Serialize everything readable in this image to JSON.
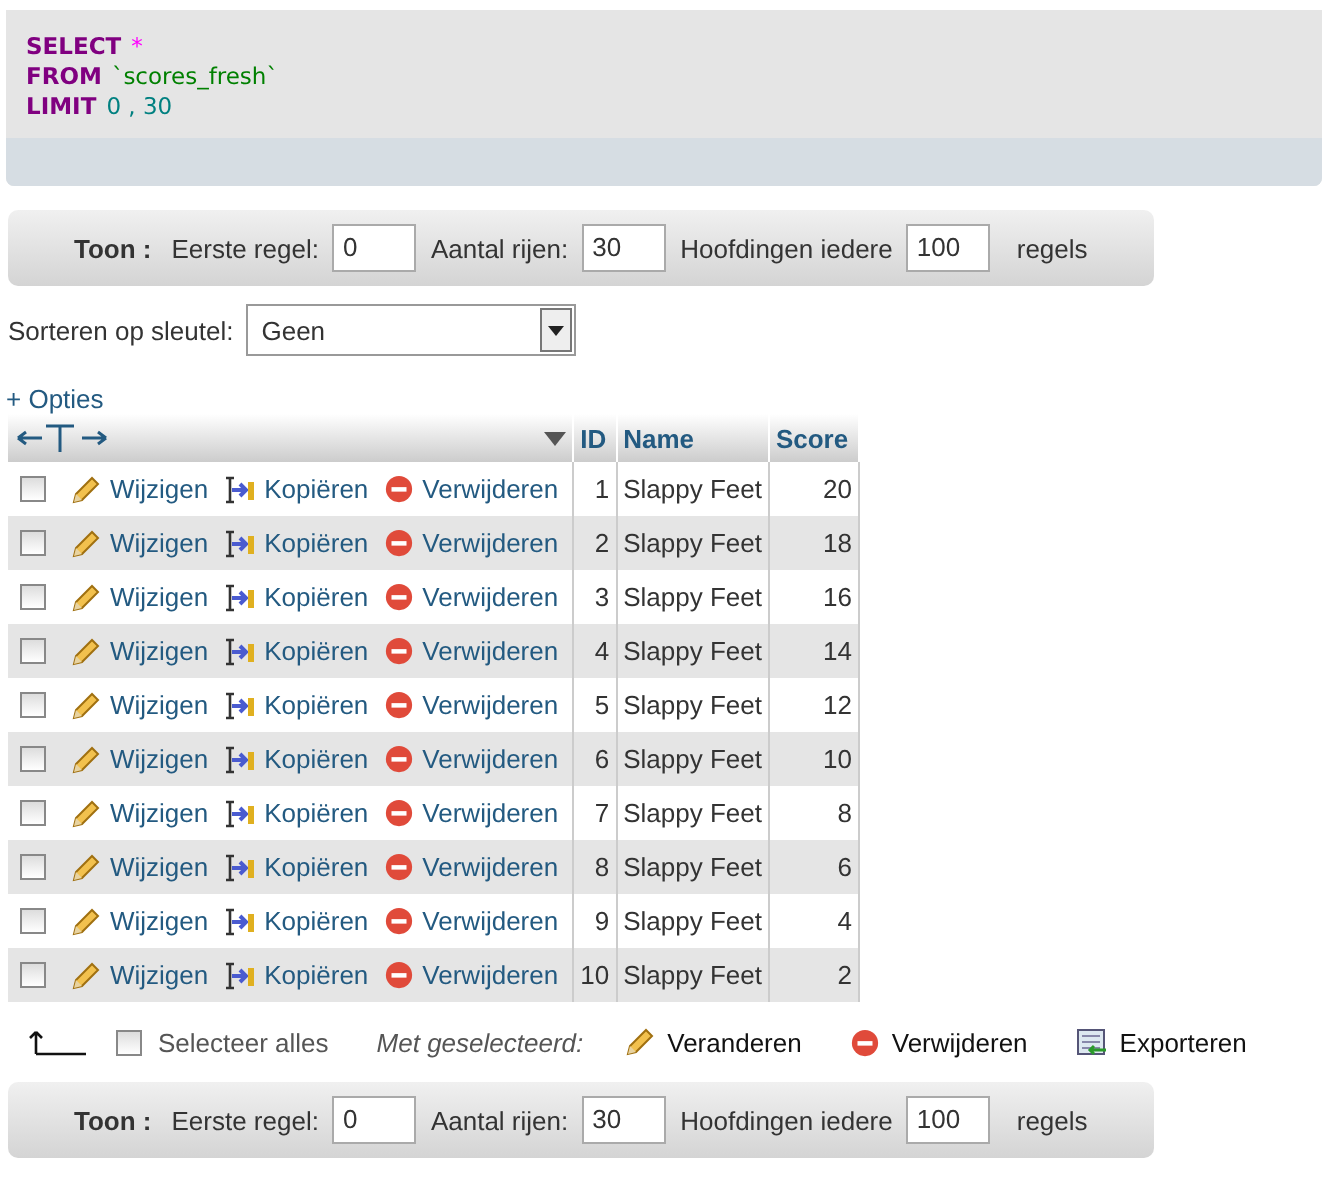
{
  "sql": [
    [
      {
        "kind": "keyword",
        "text": "SELECT"
      },
      {
        "kind": "operator",
        "text": "*"
      }
    ],
    [
      {
        "kind": "keyword",
        "text": "FROM"
      },
      {
        "kind": "string",
        "text": "`scores_fresh`"
      }
    ],
    [
      {
        "kind": "keyword",
        "text": "LIMIT"
      },
      {
        "kind": "number",
        "text": "0 , 30"
      }
    ]
  ],
  "nav_top": {
    "title": "Toon :",
    "first_label": "Eerste regel:",
    "first_value": "0",
    "rows_label": "Aantal rijen:",
    "rows_value": "30",
    "headers_label": "Hoofdingen iedere",
    "headers_value": "100",
    "suffix": "regels"
  },
  "sort": {
    "label": "Sorteren op sleutel:",
    "value": "Geen"
  },
  "options_link": "+ Opties",
  "table": {
    "columns": [
      "ID",
      "Name",
      "Score"
    ],
    "rows": [
      {
        "checked": false,
        "edit": "Wijzigen",
        "copy": "Kopiëren",
        "delete": "Verwijderen",
        "id": "1",
        "name": "Slappy Feet",
        "score": "20"
      },
      {
        "checked": false,
        "edit": "Wijzigen",
        "copy": "Kopiëren",
        "delete": "Verwijderen",
        "id": "2",
        "name": "Slappy Feet",
        "score": "18"
      },
      {
        "checked": false,
        "edit": "Wijzigen",
        "copy": "Kopiëren",
        "delete": "Verwijderen",
        "id": "3",
        "name": "Slappy Feet",
        "score": "16"
      },
      {
        "checked": false,
        "edit": "Wijzigen",
        "copy": "Kopiëren",
        "delete": "Verwijderen",
        "id": "4",
        "name": "Slappy Feet",
        "score": "14"
      },
      {
        "checked": false,
        "edit": "Wijzigen",
        "copy": "Kopiëren",
        "delete": "Verwijderen",
        "id": "5",
        "name": "Slappy Feet",
        "score": "12"
      },
      {
        "checked": false,
        "edit": "Wijzigen",
        "copy": "Kopiëren",
        "delete": "Verwijderen",
        "id": "6",
        "name": "Slappy Feet",
        "score": "10"
      },
      {
        "checked": false,
        "edit": "Wijzigen",
        "copy": "Kopiëren",
        "delete": "Verwijderen",
        "id": "7",
        "name": "Slappy Feet",
        "score": "8"
      },
      {
        "checked": false,
        "edit": "Wijzigen",
        "copy": "Kopiëren",
        "delete": "Verwijderen",
        "id": "8",
        "name": "Slappy Feet",
        "score": "6"
      },
      {
        "checked": false,
        "edit": "Wijzigen",
        "copy": "Kopiëren",
        "delete": "Verwijderen",
        "id": "9",
        "name": "Slappy Feet",
        "score": "4"
      },
      {
        "checked": false,
        "edit": "Wijzigen",
        "copy": "Kopiëren",
        "delete": "Verwijderen",
        "id": "10",
        "name": "Slappy Feet",
        "score": "2"
      }
    ]
  },
  "bulk": {
    "select_all": "Selecteer alles",
    "select_all_checked": false,
    "with_selected": "Met geselecteerd:",
    "change": "Veranderen",
    "delete": "Verwijderen",
    "export": "Exporteren"
  },
  "nav_bottom": {
    "title": "Toon :",
    "first_label": "Eerste regel:",
    "first_value": "0",
    "rows_label": "Aantal rijen:",
    "rows_value": "30",
    "headers_label": "Hoofdingen iedere",
    "headers_value": "100",
    "suffix": "regels"
  }
}
